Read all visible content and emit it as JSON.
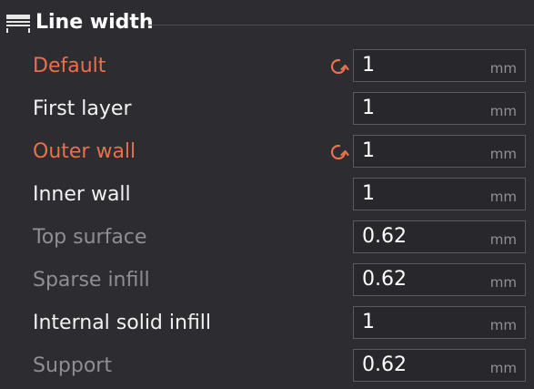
{
  "section": {
    "title": "Line width",
    "icon": "line-width-icon"
  },
  "colors": {
    "modified": "#e8704d",
    "normal": "#f2f2f2",
    "dim": "#8e8e94",
    "background": "#2d2d31"
  },
  "rows": [
    {
      "label": "Default",
      "value": "1",
      "unit": "mm",
      "state": "modified",
      "reset_icon": "reset-icon"
    },
    {
      "label": "First layer",
      "value": "1",
      "unit": "mm",
      "state": "normal"
    },
    {
      "label": "Outer wall",
      "value": "1",
      "unit": "mm",
      "state": "modified",
      "reset_icon": "reset-icon"
    },
    {
      "label": "Inner wall",
      "value": "1",
      "unit": "mm",
      "state": "normal"
    },
    {
      "label": "Top surface",
      "value": "0.62",
      "unit": "mm",
      "state": "dim"
    },
    {
      "label": "Sparse infill",
      "value": "0.62",
      "unit": "mm",
      "state": "dim"
    },
    {
      "label": "Internal solid infill",
      "value": "1",
      "unit": "mm",
      "state": "normal"
    },
    {
      "label": "Support",
      "value": "0.62",
      "unit": "mm",
      "state": "dim"
    }
  ]
}
